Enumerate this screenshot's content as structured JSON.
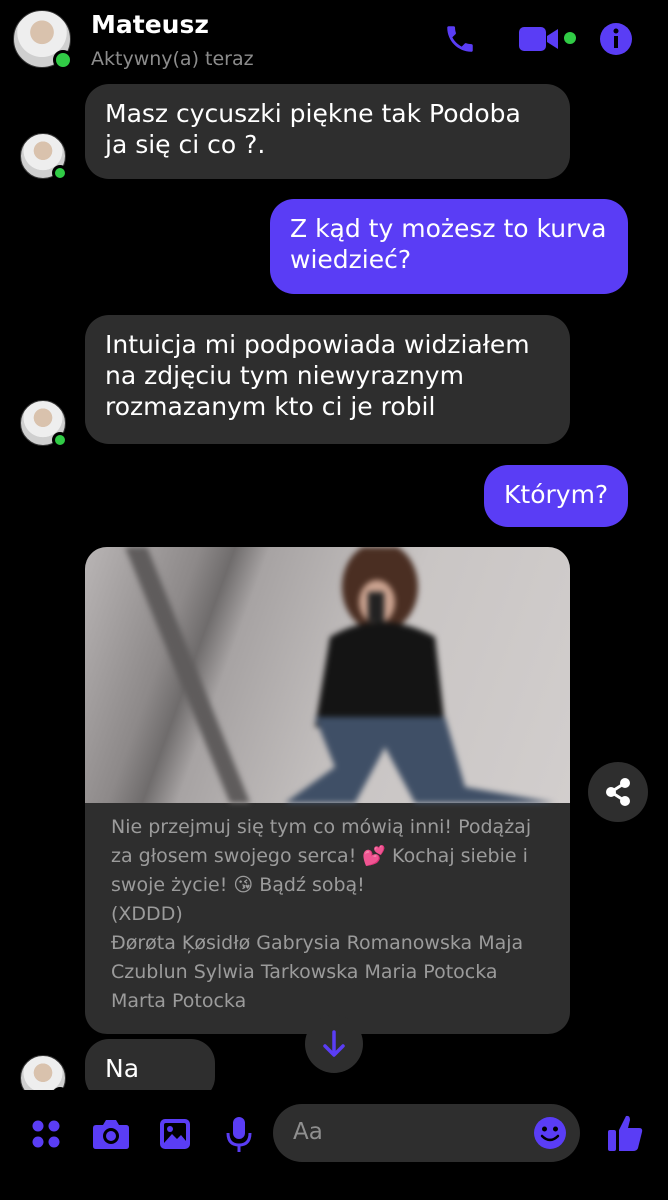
{
  "header": {
    "contact_name": "Mateusz",
    "status": "Aktywny(a) teraz",
    "accent_color": "#5a3df5",
    "icons": [
      "phone-icon",
      "video-camera-icon",
      "info-icon"
    ]
  },
  "messages": [
    {
      "side": "in",
      "text": "Masz cycuszki piękne tak Podoba ja się ci co ?."
    },
    {
      "side": "out",
      "text": "Z kąd ty możesz to kurva wiedzieć?"
    },
    {
      "side": "in",
      "text": "Intuicja mi podpowiada widziałem na zdjęciu tym niewyraznym rozmazanym kto ci je robil"
    },
    {
      "side": "out",
      "text": "Którym?"
    },
    {
      "side": "in",
      "type": "shared-post",
      "caption": "Nie przejmuj się tym co mówią inni! Podążaj za głosem swojego serca! 💕 Kochaj siebie i swoje życie! 😘 Bądź sobą!\n(XDDD)\nĐørøta Ķøsidłø Gabrysia Romanowska Maja Czublun Sylwia Tarkowska Maria Potocka\nMarta Potocka"
    },
    {
      "side": "in",
      "text": "Na tym"
    }
  ],
  "composer": {
    "placeholder": "Aa",
    "icons": [
      "apps-icon",
      "camera-icon",
      "gallery-icon",
      "microphone-icon",
      "emoji-icon",
      "thumbs-up-icon"
    ]
  }
}
